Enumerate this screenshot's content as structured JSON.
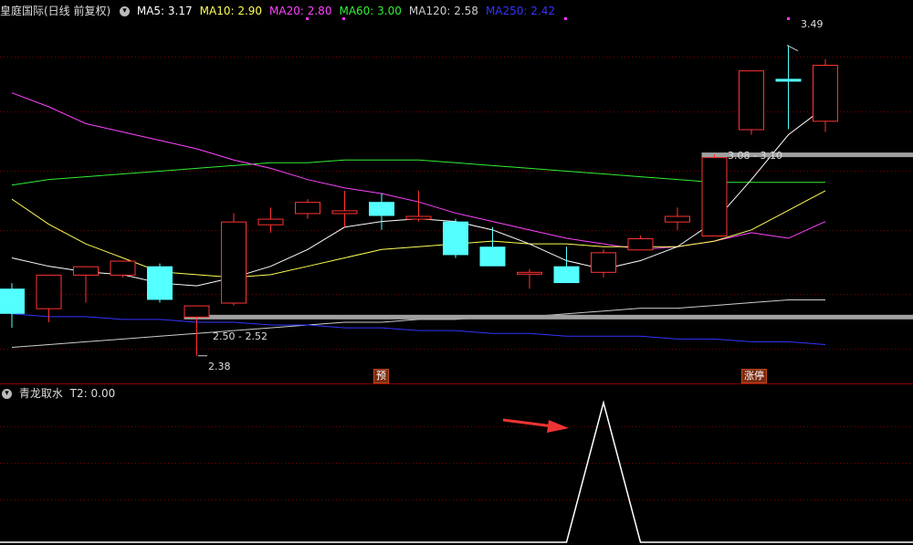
{
  "main_panel": {
    "title": "皇庭国际(日线 前复权)",
    "toggle_icon": "chevron-down-icon",
    "ma_legend": [
      {
        "label": "MA5: 3.17",
        "color": "#ffffff"
      },
      {
        "label": "MA10: 2.90",
        "color": "#ffff55"
      },
      {
        "label": "MA20: 2.80",
        "color": "#ff44ff"
      },
      {
        "label": "MA60: 3.00",
        "color": "#33ee33"
      },
      {
        "label": "MA120: 2.58",
        "color": "#cccccc"
      },
      {
        "label": "MA250: 2.42",
        "color": "#3333ff"
      }
    ],
    "annotations": {
      "high_price": "3.49",
      "low_price": "2.38",
      "upper_zone": "3.08 - 3.10",
      "lower_zone": "2.50 - 2.52",
      "tag_predict": "预",
      "tag_limit_up": "涨停"
    },
    "colors": {
      "up": "#ff3333",
      "down": "#54ffff",
      "grid": "#7a0000",
      "zone": "#a0a0a0"
    },
    "chart_data": {
      "type": "candlestick",
      "ylim": [
        2.34,
        3.58
      ],
      "candles": [
        {
          "o": 2.62,
          "h": 2.64,
          "l": 2.48,
          "c": 2.53
        },
        {
          "o": 2.55,
          "h": 2.67,
          "l": 2.5,
          "c": 2.67
        },
        {
          "o": 2.67,
          "h": 2.7,
          "l": 2.57,
          "c": 2.7
        },
        {
          "o": 2.67,
          "h": 2.72,
          "l": 2.66,
          "c": 2.72
        },
        {
          "o": 2.7,
          "h": 2.71,
          "l": 2.57,
          "c": 2.58
        },
        {
          "o": 2.52,
          "h": 2.56,
          "l": 2.38,
          "c": 2.56
        },
        {
          "o": 2.57,
          "h": 2.89,
          "l": 2.56,
          "c": 2.86
        },
        {
          "o": 2.85,
          "h": 2.91,
          "l": 2.82,
          "c": 2.87
        },
        {
          "o": 2.89,
          "h": 2.94,
          "l": 2.87,
          "c": 2.93
        },
        {
          "o": 2.89,
          "h": 2.97,
          "l": 2.84,
          "c": 2.9
        },
        {
          "o": 2.93,
          "h": 2.96,
          "l": 2.83,
          "c": 2.88
        },
        {
          "o": 2.87,
          "h": 2.97,
          "l": 2.86,
          "c": 2.88
        },
        {
          "o": 2.86,
          "h": 2.87,
          "l": 2.73,
          "c": 2.74
        },
        {
          "o": 2.77,
          "h": 2.84,
          "l": 2.7,
          "c": 2.7
        },
        {
          "o": 2.68,
          "h": 2.69,
          "l": 2.62,
          "c": 2.68
        },
        {
          "o": 2.7,
          "h": 2.77,
          "l": 2.64,
          "c": 2.64
        },
        {
          "o": 2.68,
          "h": 2.76,
          "l": 2.66,
          "c": 2.75
        },
        {
          "o": 2.76,
          "h": 2.81,
          "l": 2.76,
          "c": 2.8
        },
        {
          "o": 2.86,
          "h": 2.91,
          "l": 2.83,
          "c": 2.88
        },
        {
          "o": 2.81,
          "h": 3.1,
          "l": 2.81,
          "c": 3.09
        },
        {
          "o": 3.19,
          "h": 3.21,
          "l": 3.17,
          "c": 3.4
        },
        {
          "o": 3.37,
          "h": 3.49,
          "l": 3.19,
          "c": 3.36
        },
        {
          "o": 3.22,
          "h": 3.44,
          "l": 3.18,
          "c": 3.42
        }
      ],
      "ma5": [
        2.73,
        2.7,
        2.68,
        2.67,
        2.64,
        2.63,
        2.66,
        2.7,
        2.76,
        2.84,
        2.86,
        2.87,
        2.86,
        2.83,
        2.78,
        2.72,
        2.69,
        2.72,
        2.77,
        2.86,
        3.01,
        3.17,
        3.27
      ],
      "ma10": [
        2.94,
        2.85,
        2.78,
        2.73,
        2.68,
        2.67,
        2.66,
        2.67,
        2.7,
        2.73,
        2.76,
        2.77,
        2.78,
        2.79,
        2.78,
        2.78,
        2.77,
        2.77,
        2.77,
        2.79,
        2.83,
        2.9,
        2.97
      ],
      "ma20": [
        3.32,
        3.27,
        3.21,
        3.18,
        3.15,
        3.12,
        3.08,
        3.05,
        3.01,
        2.98,
        2.96,
        2.93,
        2.89,
        2.86,
        2.83,
        2.8,
        2.78,
        2.76,
        2.77,
        2.79,
        2.82,
        2.8,
        2.86
      ],
      "ma60": [
        2.99,
        3.01,
        3.02,
        3.03,
        3.04,
        3.05,
        3.06,
        3.07,
        3.07,
        3.08,
        3.08,
        3.08,
        3.07,
        3.06,
        3.05,
        3.04,
        3.03,
        3.02,
        3.01,
        3.0,
        3.0,
        3.0,
        3.0
      ],
      "ma120": [
        2.41,
        2.42,
        2.43,
        2.44,
        2.45,
        2.46,
        2.47,
        2.48,
        2.49,
        2.5,
        2.5,
        2.51,
        2.51,
        2.52,
        2.52,
        2.53,
        2.54,
        2.55,
        2.55,
        2.56,
        2.57,
        2.58,
        2.58
      ],
      "ma250": [
        2.53,
        2.52,
        2.52,
        2.51,
        2.51,
        2.5,
        2.5,
        2.49,
        2.49,
        2.48,
        2.48,
        2.47,
        2.47,
        2.46,
        2.46,
        2.45,
        2.45,
        2.45,
        2.44,
        2.44,
        2.43,
        2.43,
        2.42
      ],
      "zones": [
        {
          "from_index": 19,
          "value": 3.1
        },
        {
          "from_index": 5,
          "value": 2.52
        }
      ]
    }
  },
  "sub_panel": {
    "title": "青龙取水",
    "toggle_icon": "chevron-down-icon",
    "t2_label": "T2: 0.00",
    "chart_data": {
      "type": "line",
      "ylim": [
        0,
        1
      ],
      "values": [
        0,
        0,
        0,
        0,
        0,
        0,
        0,
        0,
        0,
        0,
        0,
        0,
        0,
        0,
        0,
        0,
        1,
        0,
        0,
        0,
        0,
        0,
        0
      ]
    },
    "arrow_color": "#ee3333"
  }
}
